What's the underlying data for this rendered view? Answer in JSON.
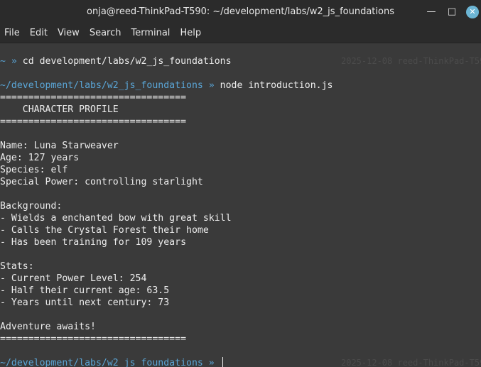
{
  "window": {
    "title": "onja@reed-ThinkPad-T590: ~/development/labs/w2_js_foundations",
    "minimize_glyph": "—",
    "maximize_glyph": "□",
    "close_glyph": "✕"
  },
  "menubar": {
    "items": [
      "File",
      "Edit",
      "View",
      "Search",
      "Terminal",
      "Help"
    ]
  },
  "terminal": {
    "prompt1": {
      "path": "~",
      "arrow": " » ",
      "command": "cd development/labs/w2_js_foundations",
      "right_ghost": "2025-12-08 reed-ThinkPad-T590"
    },
    "prompt2": {
      "path": "~/development/labs/w2_js_foundations",
      "arrow": " » ",
      "command": "node introduction.js"
    },
    "output": {
      "rule": "=================================",
      "header": "    CHARACTER PROFILE",
      "name": "Name: Luna Starweaver",
      "age": "Age: 127 years",
      "species": "Species: elf",
      "power": "Special Power: controlling starlight",
      "background_heading": "Background:",
      "background_1": "- Wields a enchanted bow with great skill",
      "background_2": "- Calls the Crystal Forest their home",
      "background_3": "- Has been training for 109 years",
      "stats_heading": "Stats:",
      "stats_1": "- Current Power Level: 254",
      "stats_2": "- Half their current age: 63.5",
      "stats_3": "- Years until next century: 73",
      "closing": "Adventure awaits!"
    },
    "prompt3": {
      "path": "~/development/labs/w2_js_foundations",
      "arrow": " » ",
      "right_ghost": "2025-12-08 reed-ThinkPad-T590"
    }
  }
}
